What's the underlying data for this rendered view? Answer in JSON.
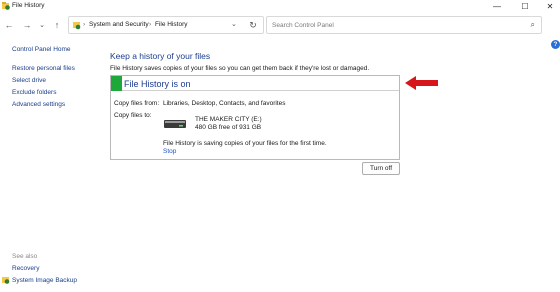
{
  "window": {
    "title": "File History",
    "minimize_glyph": "—",
    "maximize_glyph": "☐",
    "close_glyph": "✕"
  },
  "nav": {
    "back_glyph": "←",
    "forward_glyph": "→",
    "history_glyph": "⌄",
    "up_glyph": "↑",
    "crumb_sep_glyph": "›",
    "dropdown_glyph": "⌄",
    "refresh_glyph": "↻",
    "breadcrumb": [
      "System and Security",
      "File History"
    ],
    "search_placeholder": "Search Control Panel",
    "search_glyph": "⌕"
  },
  "help": {
    "glyph": "?"
  },
  "sidebar": {
    "home": "Control Panel Home",
    "links": [
      "Restore personal files",
      "Select drive",
      "Exclude folders",
      "Advanced settings"
    ],
    "see_also_heading": "See also",
    "see_also": [
      "Recovery",
      "System Image Backup"
    ]
  },
  "main": {
    "heading": "Keep a history of your files",
    "description": "File History saves copies of your files so you can get them back if they're lost or damaged.",
    "status": "File History is on",
    "copy_from_label": "Copy files from:",
    "copy_from_value": "Libraries, Desktop, Contacts, and favorites",
    "copy_to_label": "Copy files to:",
    "drive_name": "THE MAKER CITY (E:)",
    "drive_space": "480 GB free of 931 GB",
    "saving_note": "File History is saving copies of your files for the first time.",
    "stop_label": "Stop",
    "turn_off_label": "Turn off"
  },
  "colors": {
    "status_on": "#1fa83a",
    "heading": "#1b3d8f",
    "link": "#1b55c9",
    "arrow": "#d6161b"
  }
}
